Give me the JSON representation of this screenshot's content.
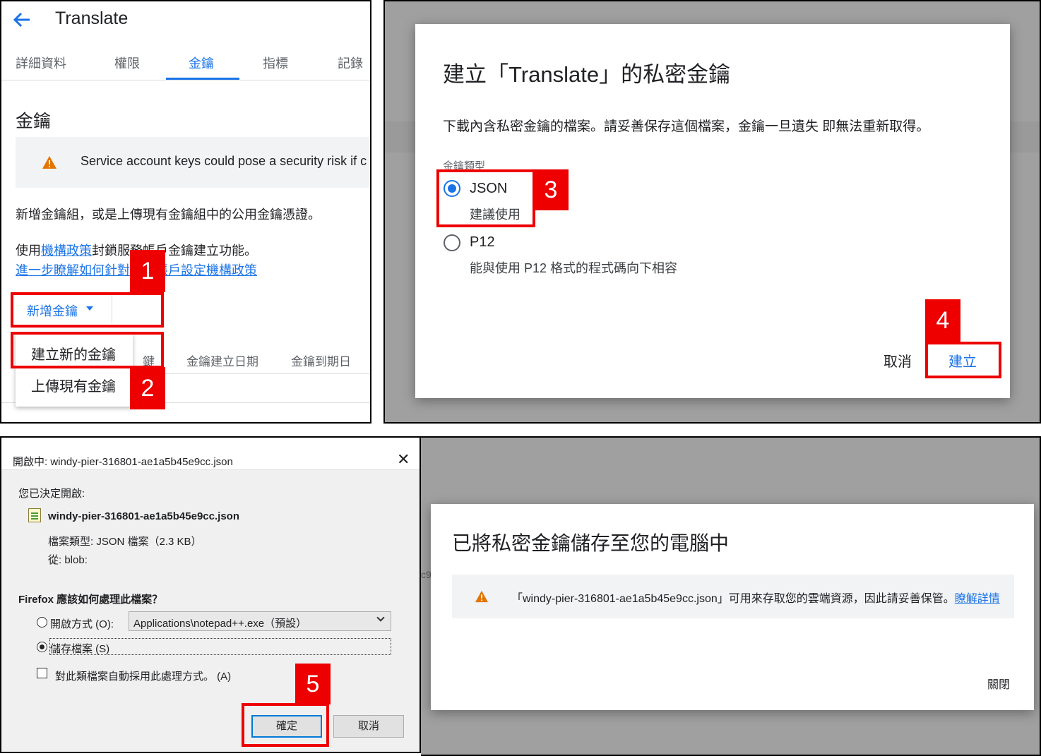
{
  "panel1": {
    "title": "Translate",
    "tabs": [
      "詳細資料",
      "權限",
      "金鑰",
      "指標",
      "記錄"
    ],
    "active_tab": "金鑰",
    "section_title": "金鑰",
    "warning": "Service account keys could pose a security risk if c",
    "desc1": "新增金鑰組，或是上傳現有金鑰組中的公用金鑰憑證。",
    "desc2_prefix": "使用",
    "desc2_link": "機構政策",
    "desc2_suffix": "封鎖服務帳戶金鑰建立功能。",
    "desc3_link": "進一步瞭解如何針對服務帳戶設定機構政策",
    "add_key_button": "新增金鑰",
    "table_headers": [
      "鍵",
      "金鑰建立日期",
      "金鑰到期日"
    ],
    "menu_items": [
      "建立新的金鑰",
      "上傳現有金鑰"
    ],
    "badges": [
      "1",
      "2"
    ]
  },
  "panel2": {
    "title": "建立「Translate」的私密金鑰",
    "description": "下載內含私密金鑰的檔案。請妥善保存這個檔案，金鑰一旦遺失 即無法重新取得。",
    "key_type_label": "金鑰類型",
    "options": [
      {
        "label": "JSON",
        "sub": "建議使用",
        "selected": true
      },
      {
        "label": "P12",
        "sub": "能與使用 P12 格式的程式碼向下相容",
        "selected": false
      }
    ],
    "cancel_button": "取消",
    "create_button": "建立",
    "badges": [
      "3",
      "4"
    ]
  },
  "panel3": {
    "window_title": "開啟中: windy-pier-316801-ae1a5b45e9cc.json",
    "decided_label": "您已決定開啟:",
    "filename": "windy-pier-316801-ae1a5b45e9cc.json",
    "file_type": "檔案類型: JSON 檔案（2.3 KB）",
    "from": "從: blob:",
    "question": "Firefox 應該如何處理此檔案？",
    "open_with_label": "開啟方式 (O):",
    "open_with_value": "Applications\\notepad++.exe（預設）",
    "save_file_label": "儲存檔案 (S)",
    "auto_label": "對此類檔案自動採用此處理方式。 (A)",
    "ok_button": "確定",
    "cancel_button": "取消",
    "badge": "5"
  },
  "panel4": {
    "bg_fragment": "c9",
    "title": "已將私密金鑰儲存至您的電腦中",
    "warning_text": "「windy-pier-316801-ae1a5b45e9cc.json」可用來存取您的雲端資源，因此請妥善保管。",
    "warning_link": "瞭解詳情",
    "close_button": "關閉"
  },
  "colors": {
    "accent": "#1a73e8",
    "highlight_red": "#ee0000",
    "warning_orange": "#e37400"
  }
}
